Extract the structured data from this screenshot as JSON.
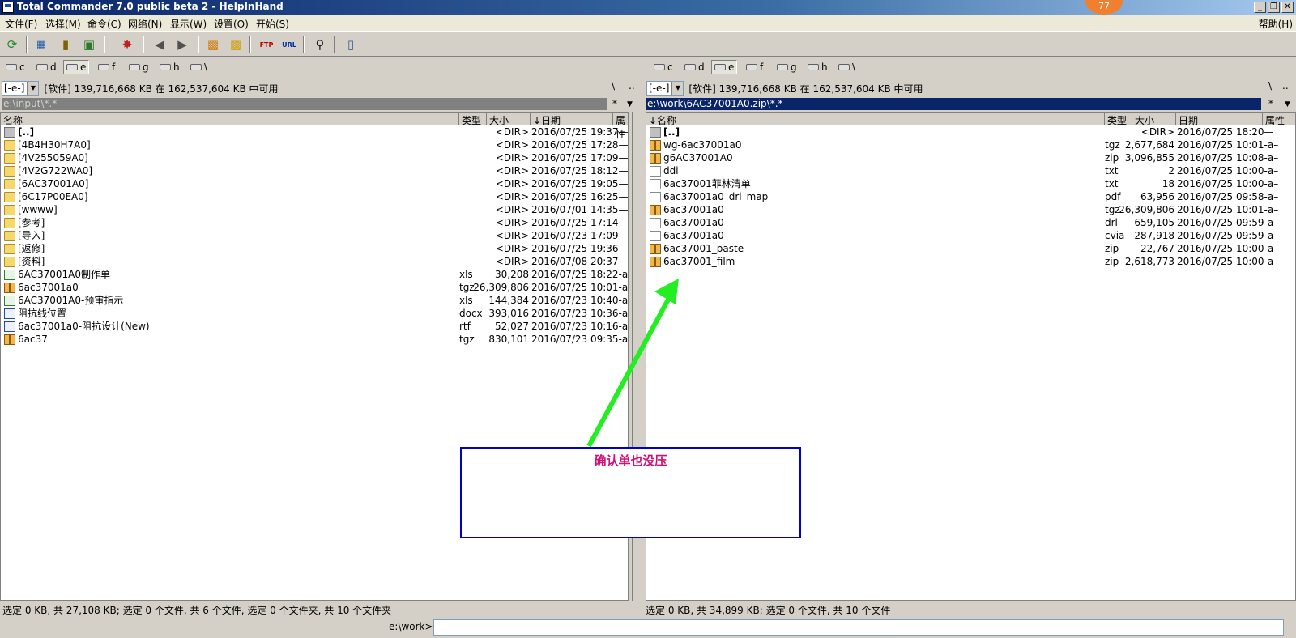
{
  "window": {
    "title": "Total Commander 7.0 public beta 2 - HelpInHand",
    "badge": "77",
    "btn_min": "_",
    "btn_max": "❐",
    "btn_close": "✕"
  },
  "menu": {
    "items": [
      "文件(F)",
      "选择(M)",
      "命令(C)",
      "网络(N)",
      "显示(W)",
      "设置(O)",
      "开始(S)"
    ],
    "help": "帮助(H)"
  },
  "toolbar": {
    "icons": [
      "refresh-icon",
      "brief-view-icon",
      "tree-view-icon",
      "thumbnail-icon",
      "invert-select-icon",
      "back-icon",
      "forward-icon",
      "pack-icon",
      "unpack-icon",
      "ftp-icon",
      "url-icon",
      "search-binoculars-icon",
      "notepad-icon"
    ],
    "ftp": "FTP",
    "url": "URL"
  },
  "left": {
    "drives": [
      "c",
      "d",
      "e",
      "f",
      "g",
      "h",
      "\\"
    ],
    "active_drive": "e",
    "drive_combo": "[-e-]",
    "volume_info": "[软件]  139,716,668 KB 在 162,537,604 KB 中可用",
    "root_btn": "\\",
    "up_btn": "..",
    "path": "e:\\input\\*.*",
    "path_star": "*",
    "path_dd": "▼",
    "headers": {
      "name": "名称",
      "type": "类型",
      "size": "大小",
      "date": "↓日期",
      "attr": "属性"
    },
    "files": [
      {
        "icon": "up",
        "name": "[..]",
        "type": "",
        "size": "<DIR>",
        "date": "2016/07/25 19:37—"
      },
      {
        "icon": "dir",
        "name": "[4B4H30H7A0]",
        "type": "",
        "size": "<DIR>",
        "date": "2016/07/25 17:28—"
      },
      {
        "icon": "dir",
        "name": "[4V255059A0]",
        "type": "",
        "size": "<DIR>",
        "date": "2016/07/25 17:09—"
      },
      {
        "icon": "dir",
        "name": "[4V2G722WA0]",
        "type": "",
        "size": "<DIR>",
        "date": "2016/07/25 18:12—"
      },
      {
        "icon": "dir",
        "name": "[6AC37001A0]",
        "type": "",
        "size": "<DIR>",
        "date": "2016/07/25 19:05—"
      },
      {
        "icon": "dir",
        "name": "[6C17P00EA0]",
        "type": "",
        "size": "<DIR>",
        "date": "2016/07/25 16:25—"
      },
      {
        "icon": "dir",
        "name": "[wwww]",
        "type": "",
        "size": "<DIR>",
        "date": "2016/07/01 14:35—"
      },
      {
        "icon": "dir",
        "name": "[参考]",
        "type": "",
        "size": "<DIR>",
        "date": "2016/07/25 17:14—"
      },
      {
        "icon": "dir",
        "name": "[导入]",
        "type": "",
        "size": "<DIR>",
        "date": "2016/07/23 17:09—"
      },
      {
        "icon": "dir",
        "name": "[返修]",
        "type": "",
        "size": "<DIR>",
        "date": "2016/07/25 19:36—"
      },
      {
        "icon": "dir",
        "name": "[资料]",
        "type": "",
        "size": "<DIR>",
        "date": "2016/07/08 20:37—"
      },
      {
        "icon": "xls",
        "name": "6AC37001A0制作单",
        "type": "xls",
        "size": "30,208",
        "date": "2016/07/25 18:22-a–"
      },
      {
        "icon": "arc",
        "name": "6ac37001a0",
        "type": "tgz",
        "size": "26,309,806",
        "date": "2016/07/25 10:01-a–"
      },
      {
        "icon": "xls",
        "name": "6AC37001A0-预审指示",
        "type": "xls",
        "size": "144,384",
        "date": "2016/07/23 10:40-a–"
      },
      {
        "icon": "doc",
        "name": "阻抗线位置",
        "type": "docx",
        "size": "393,016",
        "date": "2016/07/23 10:36-a–"
      },
      {
        "icon": "doc",
        "name": "6ac37001a0-阻抗设计(New)",
        "type": "rtf",
        "size": "52,027",
        "date": "2016/07/23 10:16-a–"
      },
      {
        "icon": "arc",
        "name": "6ac37",
        "type": "tgz",
        "size": "830,101",
        "date": "2016/07/23 09:35-a–"
      }
    ],
    "status": "选定 0 KB, 共 27,108 KB; 选定 0 个文件, 共 6 个文件, 选定 0 个文件夹, 共 10 个文件夹"
  },
  "right": {
    "drives": [
      "c",
      "d",
      "e",
      "f",
      "g",
      "h",
      "\\"
    ],
    "active_drive": "e",
    "drive_combo": "[-e-]",
    "volume_info": "[软件]  139,716,668 KB 在 162,537,604 KB 中可用",
    "root_btn": "\\",
    "up_btn": "..",
    "path": "e:\\work\\6AC37001A0.zip\\*.*",
    "path_star": "*",
    "path_dd": "▼",
    "headers": {
      "name": "↓名称",
      "type": "类型",
      "size": "大小",
      "date": "日期",
      "attr": "属性"
    },
    "files": [
      {
        "icon": "up",
        "name": "[..]",
        "type": "",
        "size": "<DIR>",
        "date": "2016/07/25 18:20—"
      },
      {
        "icon": "arc",
        "name": "wg-6ac37001a0",
        "type": "tgz",
        "size": "2,677,684",
        "date": "2016/07/25 10:01-a–"
      },
      {
        "icon": "arc",
        "name": "g6AC37001A0",
        "type": "zip",
        "size": "3,096,855",
        "date": "2016/07/25 10:08-a–"
      },
      {
        "icon": "txt",
        "name": "ddi",
        "type": "txt",
        "size": "2",
        "date": "2016/07/25 10:00-a–"
      },
      {
        "icon": "txt",
        "name": "6ac37001菲林清单",
        "type": "txt",
        "size": "18",
        "date": "2016/07/25 10:00-a–"
      },
      {
        "icon": "txt",
        "name": "6ac37001a0_drl_map",
        "type": "pdf",
        "size": "63,956",
        "date": "2016/07/25 09:58-a–"
      },
      {
        "icon": "arc",
        "name": "6ac37001a0",
        "type": "tgz",
        "size": "26,309,806",
        "date": "2016/07/25 10:01-a–"
      },
      {
        "icon": "txt",
        "name": "6ac37001a0",
        "type": "drl",
        "size": "659,105",
        "date": "2016/07/25 09:59-a–"
      },
      {
        "icon": "txt",
        "name": "6ac37001a0",
        "type": "cvia",
        "size": "287,918",
        "date": "2016/07/25 09:59-a–"
      },
      {
        "icon": "arc",
        "name": "6ac37001_paste",
        "type": "zip",
        "size": "22,767",
        "date": "2016/07/25 10:00-a–"
      },
      {
        "icon": "arc",
        "name": "6ac37001_film",
        "type": "zip",
        "size": "2,618,773",
        "date": "2016/07/25 10:00-a–"
      }
    ],
    "status": "选定 0 KB, 共 34,899 KB; 选定 0 个文件, 共 10 个文件"
  },
  "cmdline": {
    "label": "e:\\work>"
  },
  "annotation": {
    "text": "确认单也没压"
  },
  "colors": {
    "arrow": "#22ee22",
    "box_border": "#0000cc",
    "note_text": "#cc1177",
    "active_path": "#0a246a"
  }
}
